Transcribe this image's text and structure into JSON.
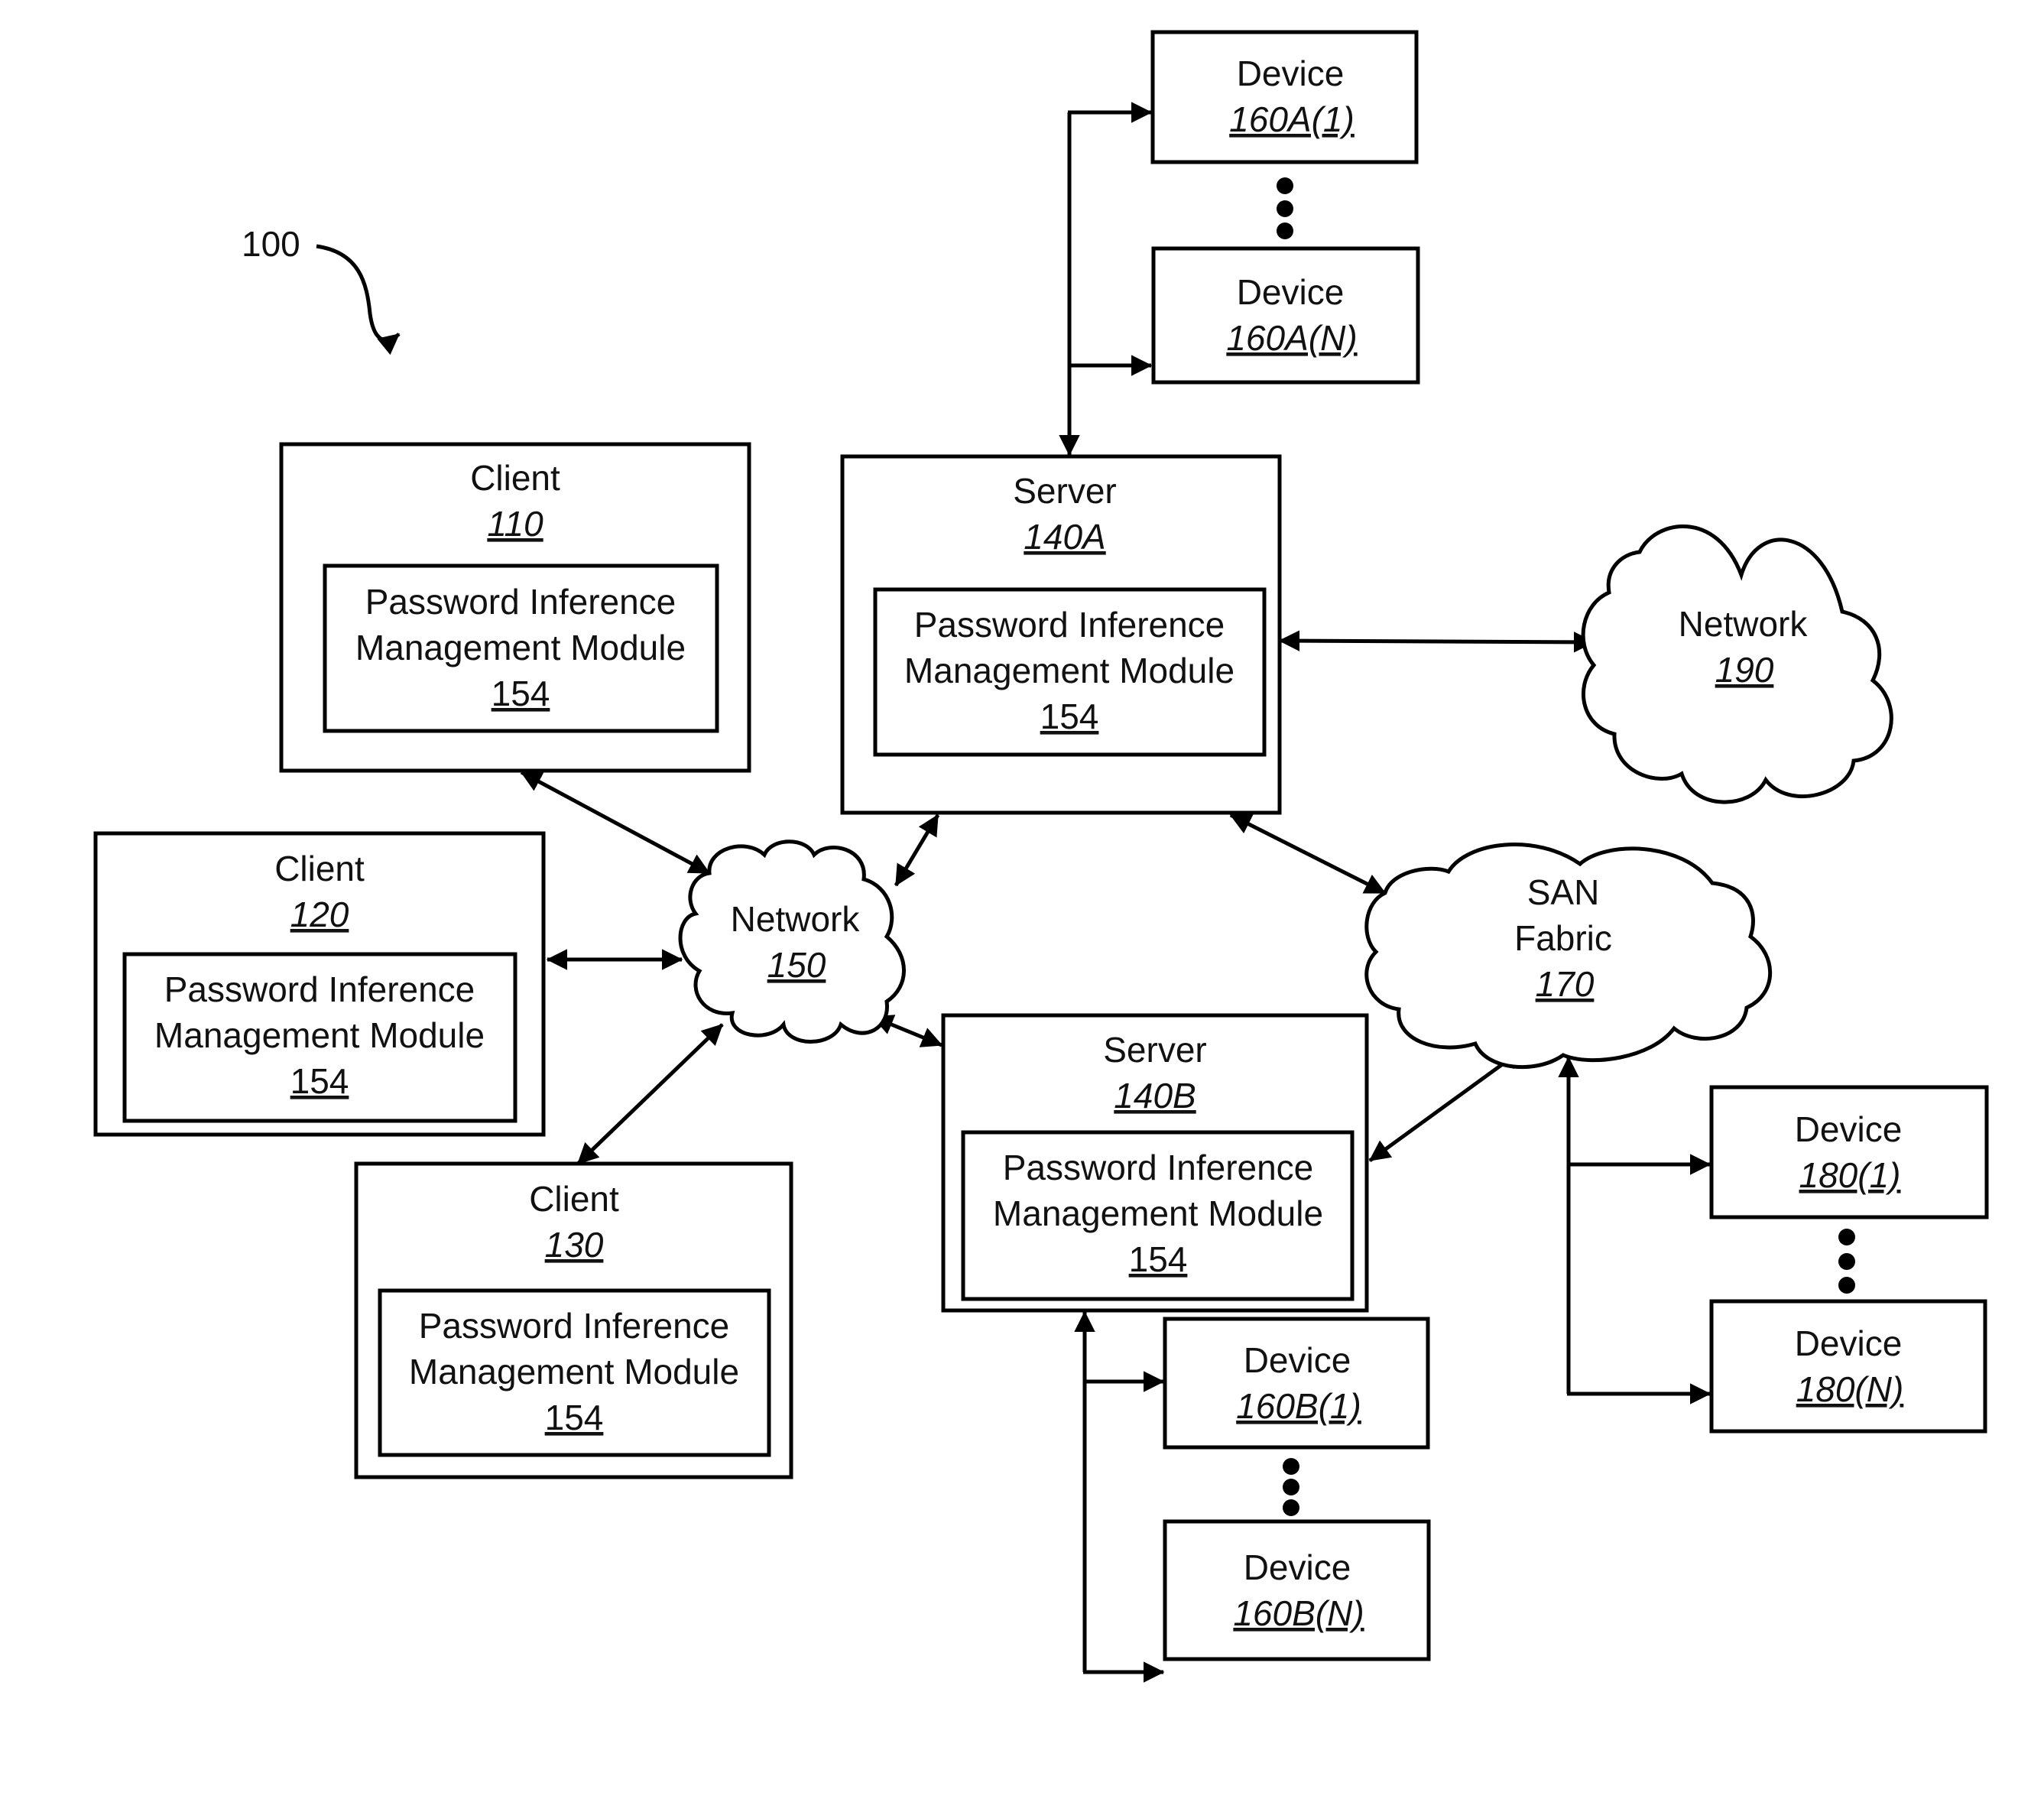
{
  "figure": {
    "reference": "100"
  },
  "clients": [
    {
      "title": "Client",
      "ref": "110",
      "module": {
        "line1": "Password Inference",
        "line2": "Management Module",
        "ref": "154"
      }
    },
    {
      "title": "Client",
      "ref": "120",
      "module": {
        "line1": "Password Inference",
        "line2": "Management Module",
        "ref": "154"
      }
    },
    {
      "title": "Client",
      "ref": "130",
      "module": {
        "line1": "Password Inference",
        "line2": "Management Module",
        "ref": "154"
      }
    }
  ],
  "servers": [
    {
      "title": "Server",
      "ref": "140A",
      "module": {
        "line1": "Password Inference",
        "line2": "Management Module",
        "ref": "154"
      }
    },
    {
      "title": "Server",
      "ref": "140B",
      "module": {
        "line1": "Password Inference",
        "line2": "Management Module",
        "ref": "154"
      }
    }
  ],
  "networks": [
    {
      "title": "Network",
      "ref": "150"
    },
    {
      "title": "Network",
      "ref": "190"
    }
  ],
  "san": {
    "line1": "SAN",
    "line2": "Fabric",
    "ref": "170"
  },
  "devices": {
    "d160a1": {
      "title": "Device",
      "ref": "160A(1)"
    },
    "d160aN": {
      "title": "Device",
      "ref": "160A(N)"
    },
    "d160b1": {
      "title": "Device",
      "ref": "160B(1)"
    },
    "d160bN": {
      "title": "Device",
      "ref": "160B(N)"
    },
    "d1801": {
      "title": "Device",
      "ref": "180(1)"
    },
    "d180N": {
      "title": "Device",
      "ref": "180(N)"
    }
  },
  "connections": [
    {
      "from": "Client 110",
      "to": "Network 150",
      "type": "bidirectional"
    },
    {
      "from": "Client 120",
      "to": "Network 150",
      "type": "bidirectional"
    },
    {
      "from": "Client 130",
      "to": "Network 150",
      "type": "bidirectional"
    },
    {
      "from": "Server 140A",
      "to": "Network 150",
      "type": "bidirectional"
    },
    {
      "from": "Server 140B",
      "to": "Network 150",
      "type": "bidirectional"
    },
    {
      "from": "Server 140A",
      "to": "Network 190",
      "type": "bidirectional"
    },
    {
      "from": "Server 140A",
      "to": "SAN Fabric 170",
      "type": "bidirectional"
    },
    {
      "from": "Server 140B",
      "to": "SAN Fabric 170",
      "type": "bidirectional"
    },
    {
      "from": "Server 140A",
      "to": "Devices 160A(1)-160A(N)",
      "type": "bus"
    },
    {
      "from": "Server 140B",
      "to": "Devices 160B(1)-160B(N)",
      "type": "bus"
    },
    {
      "from": "SAN Fabric 170",
      "to": "Devices 180(1)-180(N)",
      "type": "bus"
    }
  ]
}
